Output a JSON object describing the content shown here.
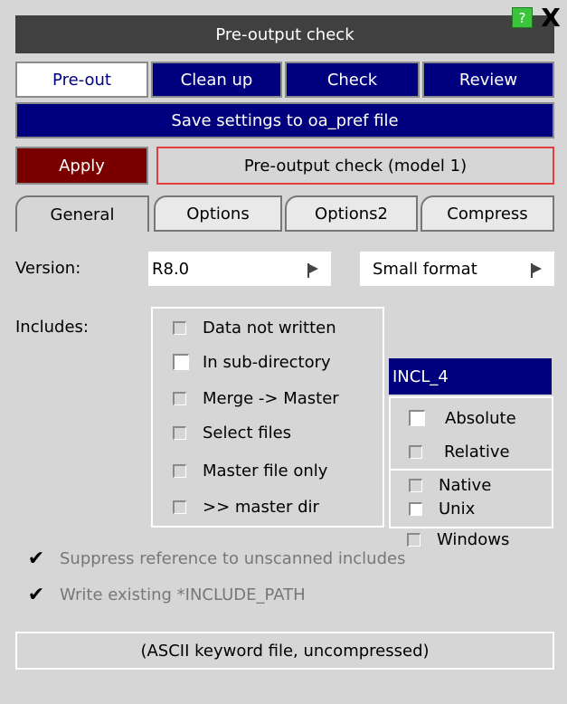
{
  "window": {
    "title": "Pre-output check",
    "help_label": "?",
    "close_label": "X"
  },
  "tabs": [
    {
      "label": "Pre-out",
      "active": true
    },
    {
      "label": "Clean up",
      "active": false
    },
    {
      "label": "Check",
      "active": false
    },
    {
      "label": "Review",
      "active": false
    }
  ],
  "save_settings_label": "Save settings to oa_pref file",
  "apply_label": "Apply",
  "model_label": "Pre-output check (model 1)",
  "subtabs": [
    {
      "label": "General",
      "active": true
    },
    {
      "label": "Options",
      "active": false
    },
    {
      "label": "Options2",
      "active": false
    },
    {
      "label": "Compress",
      "active": false
    }
  ],
  "version": {
    "label": "Version:",
    "value": "R8.0",
    "format_value": "Small format"
  },
  "includes": {
    "label": "Includes:",
    "options": [
      {
        "label": "Data not written",
        "checked": false,
        "white": false
      },
      {
        "label": "In sub-directory",
        "checked": false,
        "white": true
      },
      {
        "label": "Merge -> Master",
        "checked": false,
        "white": false
      },
      {
        "label": "Select files",
        "checked": false,
        "white": false
      },
      {
        "label": "Master file only",
        "checked": false,
        "white": false
      },
      {
        "label": ">> master dir",
        "checked": false,
        "white": false
      }
    ],
    "name_value": "INCL_4",
    "path_options": [
      {
        "label": "Absolute",
        "white": true
      },
      {
        "label": "Relative",
        "white": false
      }
    ],
    "os_options": [
      {
        "label": "Native",
        "white": false
      },
      {
        "label": "Unix",
        "white": true
      },
      {
        "label": "Windows",
        "white": false
      }
    ]
  },
  "checks": [
    {
      "label": "Suppress reference to unscanned includes",
      "checked": true
    },
    {
      "label": "Write existing *INCLUDE_PATH",
      "checked": true
    }
  ],
  "footer_label": "(ASCII keyword file, uncompressed)",
  "colors": {
    "panel_bg": "#d6d6d6",
    "title_bg": "#404040",
    "tab_blue": "#00007e",
    "apply_red": "#7a0000",
    "help_green": "#3cc43c"
  }
}
